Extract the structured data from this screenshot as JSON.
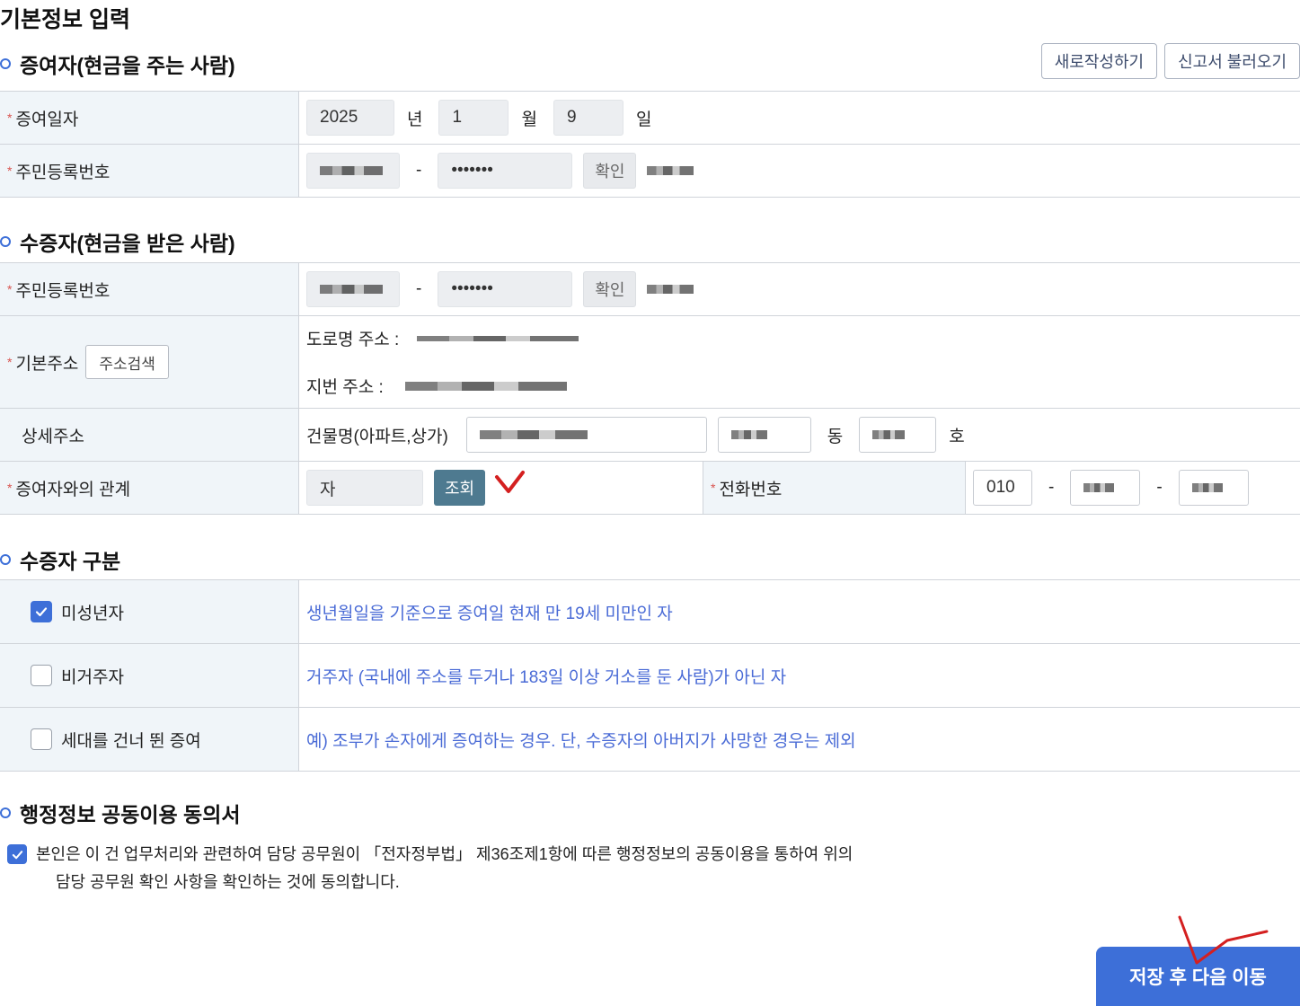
{
  "page_title": "기본정보 입력",
  "top_buttons": {
    "new": "새로작성하기",
    "load": "신고서 불러오기"
  },
  "donor": {
    "title": "증여자(현금을 주는 사람)",
    "gift_date": {
      "label": "증여일자",
      "year": "2025",
      "year_unit": "년",
      "month": "1",
      "month_unit": "월",
      "day": "9",
      "day_unit": "일"
    },
    "rrn": {
      "label": "주민등록번호",
      "masked": "•••••••",
      "dash": "-",
      "confirm": "확인"
    }
  },
  "donee": {
    "title": "수증자(현금을 받은 사람)",
    "rrn": {
      "label": "주민등록번호",
      "masked": "•••••••",
      "dash": "-",
      "confirm": "확인"
    },
    "address": {
      "label": "기본주소",
      "search": "주소검색",
      "road": "도로명 주소 :",
      "jibun": "지번 주소 :"
    },
    "detail": {
      "label": "상세주소",
      "building": "건물명(아파트,상가)",
      "dong": "동",
      "ho": "호"
    },
    "relation": {
      "label": "증여자와의 관계",
      "value": "자",
      "lookup": "조회"
    },
    "phone": {
      "label": "전화번호",
      "first": "010",
      "dash": "-"
    }
  },
  "donee_type": {
    "title": "수증자 구분",
    "items": [
      {
        "label": "미성년자",
        "checked": true,
        "desc": "생년월일을 기준으로 증여일 현재 만 19세 미만인 자"
      },
      {
        "label": "비거주자",
        "checked": false,
        "desc": "거주자 (국내에 주소를 두거나 183일 이상 거소를 둔 사람)가 아닌 자"
      },
      {
        "label": "세대를 건너 뛴 증여",
        "checked": false,
        "desc": "예) 조부가 손자에게 증여하는 경우. 단, 수증자의 아버지가 사망한 경우는 제외"
      }
    ]
  },
  "consent": {
    "title": "행정정보 공동이용 동의서",
    "line1": "본인은 이 건 업무처리와 관련하여 담당 공무원이 「전자정부법」 제36조제1항에 따른 행정정보의 공동이용을 통하여 위의",
    "line2": "담당 공무원 확인 사항을 확인하는 것에 동의합니다.",
    "checked": true
  },
  "submit": "저장 후 다음 이동",
  "colors": {
    "accent": "#3d6fd8",
    "label_bg": "#f0f5f9",
    "teal": "#4e7a90",
    "required": "#d9534f",
    "annotation": "#d42020"
  }
}
